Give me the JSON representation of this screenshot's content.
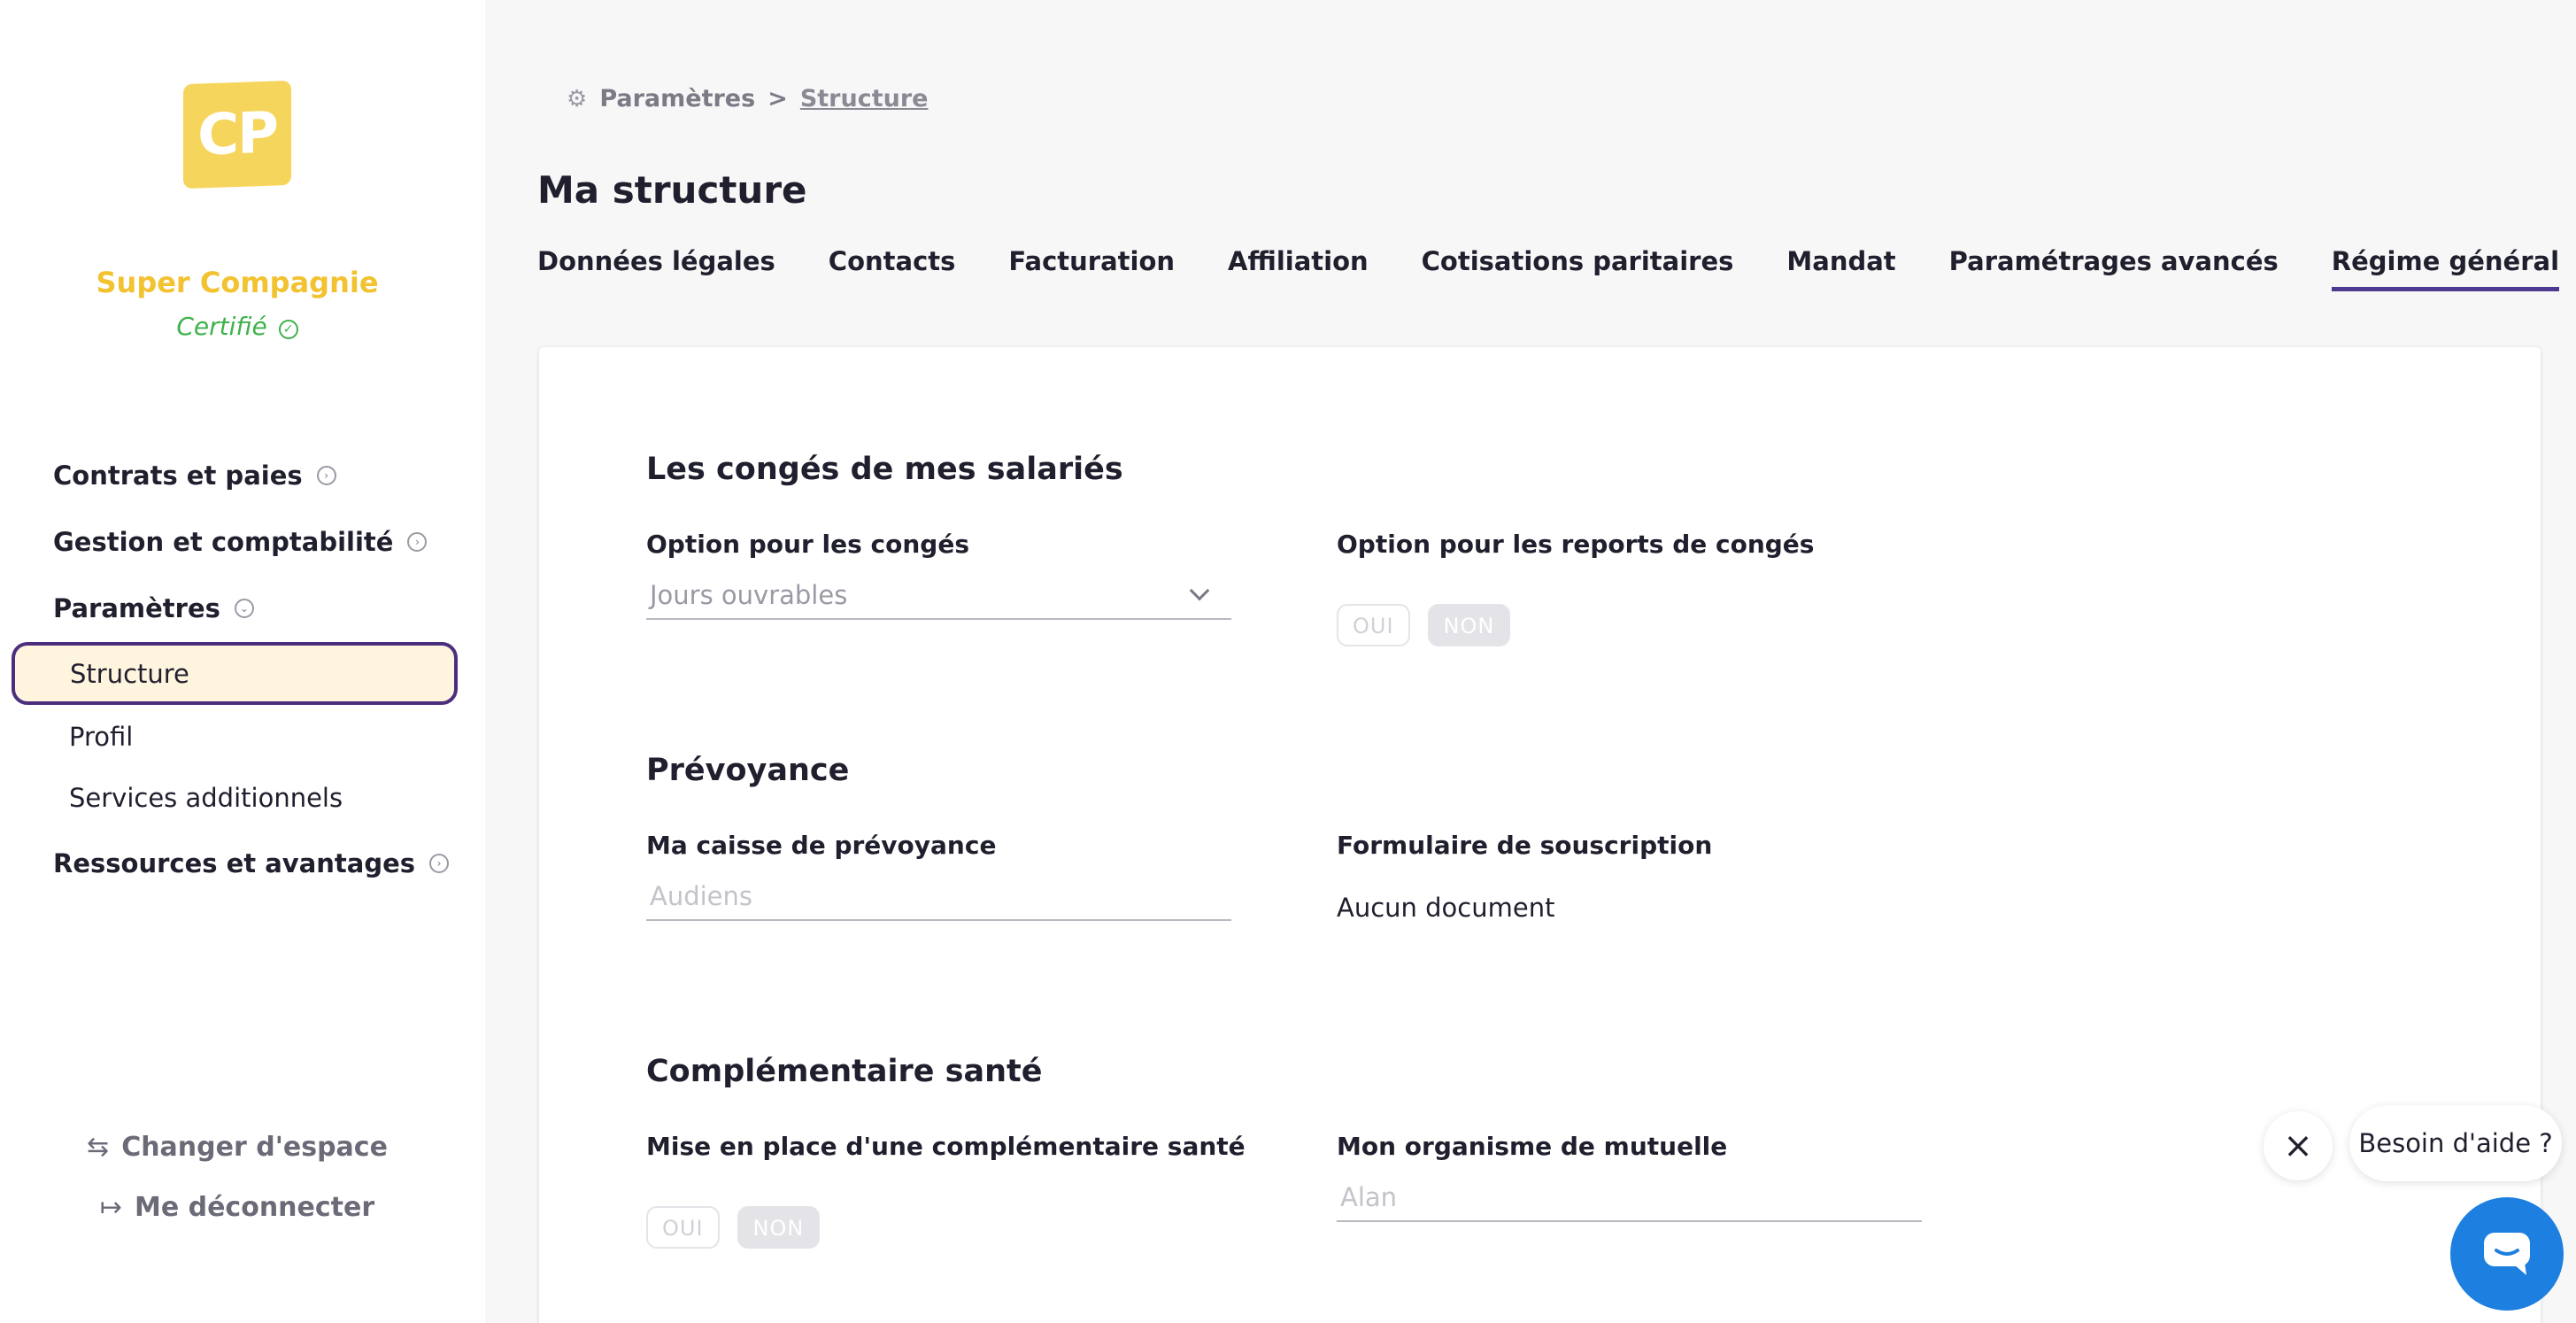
{
  "sidebar": {
    "logo_text": "CP",
    "company_name": "Super Compagnie",
    "certified_label": "Certifié",
    "nav": [
      {
        "label": "Contrats et paies"
      },
      {
        "label": "Gestion et comptabilité"
      },
      {
        "label": "Paramètres"
      },
      {
        "label": "Ressources et avantages"
      }
    ],
    "sub_items": [
      {
        "label": "Structure",
        "active": true
      },
      {
        "label": "Profil"
      },
      {
        "label": "Services additionnels"
      }
    ],
    "bottom": {
      "switch_label": "Changer d'espace",
      "logout_label": "Me déconnecter"
    }
  },
  "breadcrumb": {
    "root": "Paramètres",
    "separator": ">",
    "current": "Structure"
  },
  "page_title": "Ma structure",
  "tabs": [
    {
      "label": "Données légales"
    },
    {
      "label": "Contacts"
    },
    {
      "label": "Facturation"
    },
    {
      "label": "Affiliation"
    },
    {
      "label": "Cotisations paritaires"
    },
    {
      "label": "Mandat"
    },
    {
      "label": "Paramétrages avancés"
    },
    {
      "label": "Régime général",
      "active": true
    }
  ],
  "sections": {
    "conges": {
      "title": "Les congés de mes salariés",
      "option_label": "Option pour les congés",
      "option_value": "Jours ouvrables",
      "reports_label": "Option pour les reports de congés",
      "yes": "OUI",
      "no": "NON"
    },
    "prevoyance": {
      "title": "Prévoyance",
      "caisse_label": "Ma caisse de prévoyance",
      "caisse_value": "Audiens",
      "formulaire_label": "Formulaire de souscription",
      "formulaire_value": "Aucun document"
    },
    "sante": {
      "title": "Complémentaire santé",
      "mise_label": "Mise en place d'une complémentaire santé",
      "yes": "OUI",
      "no": "NON",
      "mutuelle_label": "Mon organisme de mutuelle",
      "mutuelle_value": "Alan"
    }
  },
  "help": {
    "bubble_text": "Besoin d'aide ?"
  },
  "colors": {
    "accent": "#4b3a8f",
    "brand_yellow": "#f2c231",
    "certified_green": "#3fb24c",
    "active_bg": "#fff4de",
    "help_blue": "#1d7fe0"
  },
  "icons": [
    "check-circle-icon",
    "chevron-circle-icon",
    "gear-icon",
    "chevron-down-icon",
    "switch-arrows-icon",
    "logout-icon",
    "close-icon",
    "chat-icon"
  ]
}
